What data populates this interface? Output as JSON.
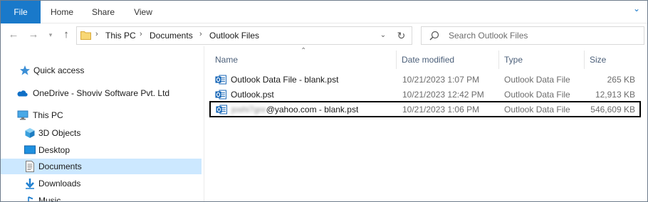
{
  "ribbon": {
    "tabs": [
      "File",
      "Home",
      "Share",
      "View"
    ],
    "expand_icon": "chevron-down-icon"
  },
  "address": {
    "crumbs": [
      "This PC",
      "Documents",
      "Outlook Files"
    ]
  },
  "search": {
    "placeholder": "Search Outlook Files"
  },
  "nav": {
    "items": [
      {
        "label": "Quick access",
        "icon": "star-icon"
      },
      {
        "label": "OneDrive - Shoviv Software Pvt. Ltd",
        "icon": "cloud-icon"
      },
      {
        "label": "This PC",
        "icon": "computer-icon"
      },
      {
        "label": "3D Objects",
        "icon": "cube-icon"
      },
      {
        "label": "Desktop",
        "icon": "desktop-icon"
      },
      {
        "label": "Documents",
        "icon": "document-icon"
      },
      {
        "label": "Downloads",
        "icon": "download-icon"
      },
      {
        "label": "Music",
        "icon": "music-icon"
      }
    ],
    "selected": "Documents"
  },
  "columns": {
    "name": "Name",
    "date": "Date modified",
    "type": "Type",
    "size": "Size"
  },
  "files": [
    {
      "name": "Outlook Data File - blank.pst",
      "date": "10/21/2023 1:07 PM",
      "type": "Outlook Data File",
      "size": "265 KB"
    },
    {
      "name": "Outlook.pst",
      "date": "10/21/2023 12:42 PM",
      "type": "Outlook Data File",
      "size": "12,913 KB"
    },
    {
      "name_blurred": "joshi7gnr",
      "name": "@yahoo.com - blank.pst",
      "date": "10/21/2023 1:06 PM",
      "type": "Outlook Data File",
      "size": "546,609 KB"
    }
  ],
  "colors": {
    "file_tab": "#1979ca",
    "selected_nav": "#cce8ff",
    "header_text": "#4c607a",
    "highlight_border": "#000000"
  }
}
